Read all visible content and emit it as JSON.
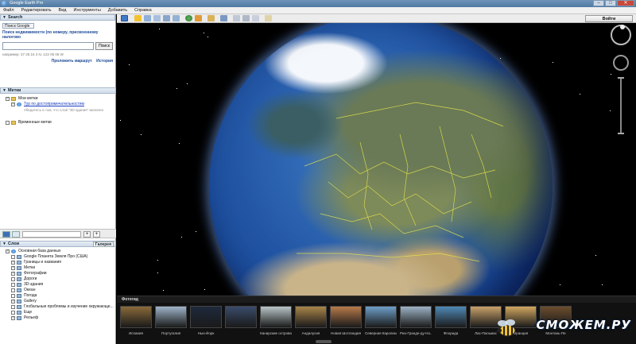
{
  "window": {
    "title": "Google Earth Pro"
  },
  "menu": [
    "Файл",
    "Редактировать",
    "Вид",
    "Инструменты",
    "Добавить",
    "Справка"
  ],
  "search": {
    "header": "Search",
    "tab": "Поиск Google",
    "description": "Поиск недвижимости (по номеру, присвоенному налогово",
    "button": "Поиск",
    "input_value": "",
    "example": "например: 37 25.16 3 N, 122 05 06 W",
    "links": [
      "Проложить маршрут",
      "История"
    ]
  },
  "places": {
    "header": "Метки",
    "items": [
      {
        "label": "Мои метки",
        "checked": true
      },
      {
        "label": "Тур по достопримечательностям",
        "checked": true,
        "hint": "Убедитесь в том, что слой \"3D-здания\" включен"
      },
      {
        "label": "Временные метки",
        "checked": false
      }
    ]
  },
  "layers": {
    "header": "Слои",
    "gallery_button": "Галерея",
    "items": [
      {
        "label": "Основная база данных",
        "checked": true
      },
      {
        "label": "Google Планета Земля Про (США)",
        "checked": false
      },
      {
        "label": "Границы и названия",
        "checked": true
      },
      {
        "label": "Метки",
        "checked": true
      },
      {
        "label": "Фотографии",
        "checked": true
      },
      {
        "label": "Дороги",
        "checked": false
      },
      {
        "label": "3D-здания",
        "checked": false
      },
      {
        "label": "Океан",
        "checked": false
      },
      {
        "label": "Погода",
        "checked": false
      },
      {
        "label": "Gallery",
        "checked": true
      },
      {
        "label": "Глобальные проблемы и изучение окружающе...",
        "checked": false
      },
      {
        "label": "Еще",
        "checked": false
      },
      {
        "label": "Рельеф",
        "checked": true
      }
    ]
  },
  "toolbar": {
    "signin": "Войти"
  },
  "photostrip": {
    "header": "Фотогид",
    "photos": [
      {
        "caption": "Испания",
        "color": "#8a6a3a"
      },
      {
        "caption": "Португалия",
        "color": "#9fb5c9"
      },
      {
        "caption": "Нью-Йорк",
        "color": "#1e2a3c"
      },
      {
        "caption": "",
        "color": "#3a4c6a"
      },
      {
        "caption": "Канарские острова",
        "color": "#b9c5c8"
      },
      {
        "caption": "Андалусия",
        "color": "#a98449"
      },
      {
        "caption": "Новая Шотландия",
        "color": "#b77a4a"
      },
      {
        "caption": "Северная Каролина",
        "color": "#6e9fc9"
      },
      {
        "caption": "Рио-Гранде-ду-Но...",
        "color": "#9db3c5"
      },
      {
        "caption": "Флорида",
        "color": "#4f89b6"
      },
      {
        "caption": "Лас-Пальмас",
        "color": "#c9a26a"
      },
      {
        "caption": "Франция",
        "color": "#d1a760"
      },
      {
        "caption": "Монтань-Пе",
        "color": "#6b4d2e"
      }
    ]
  },
  "watermark": {
    "text": "СМОЖЕМ.РУ"
  }
}
